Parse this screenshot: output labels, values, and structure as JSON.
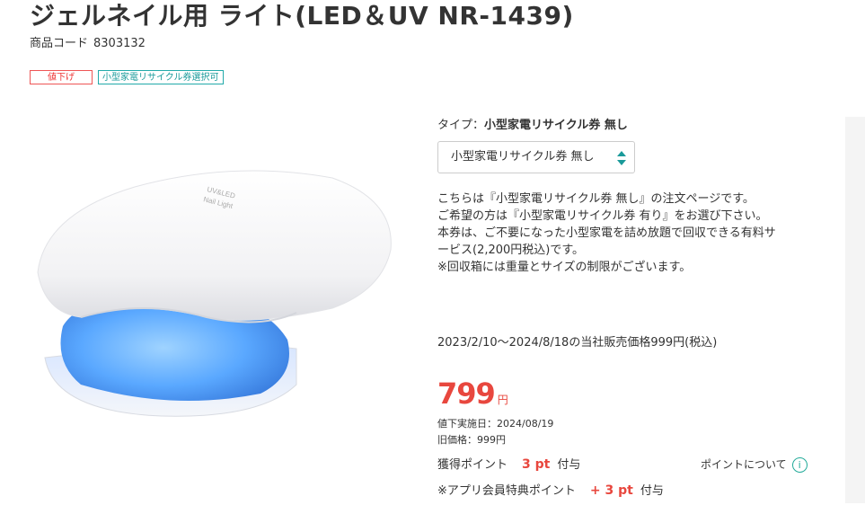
{
  "product": {
    "title": "ジェルネイル用 ライト(LED＆UV NR-1439)",
    "code_label": "商品コード",
    "code_value": "8303132",
    "badges": {
      "sale": "値下げ",
      "recycle": "小型家電リサイクル券選択可"
    },
    "image_text": "UV&LED Nail Light"
  },
  "type_selector": {
    "label": "タイプ：",
    "selected_bold": "小型家電リサイクル券 無し",
    "select_value": "小型家電リサイクル券 無し"
  },
  "description": [
    "こちらは『小型家電リサイクル券 無し』の注文ページです。",
    "ご希望の方は『小型家電リサイクル券 有り』をお選び下さい。",
    "本券は、ご不要になった小型家電を詰め放題で回収できる有料サ",
    "ービス(2,200円税込)です。",
    "※回収箱には重量とサイズの制限がございます。"
  ],
  "pricing": {
    "period_text": "2023/2/10～2024/8/18の当社販売価格999円(税込)",
    "price": "799",
    "currency": "円",
    "reduction_date": "値下実施日：2024/08/19",
    "old_price": "旧価格：999円"
  },
  "points": {
    "earn_label": "獲得ポイント",
    "earn_value": "3 pt",
    "earn_suffix": "付与",
    "about_link": "ポイントについて",
    "app_label": "※アプリ会員特典ポイント",
    "app_value": "+ 3 pt",
    "app_suffix": "付与"
  },
  "colors": {
    "accent_red": "#e8473e",
    "accent_teal": "#1a9a9a"
  }
}
